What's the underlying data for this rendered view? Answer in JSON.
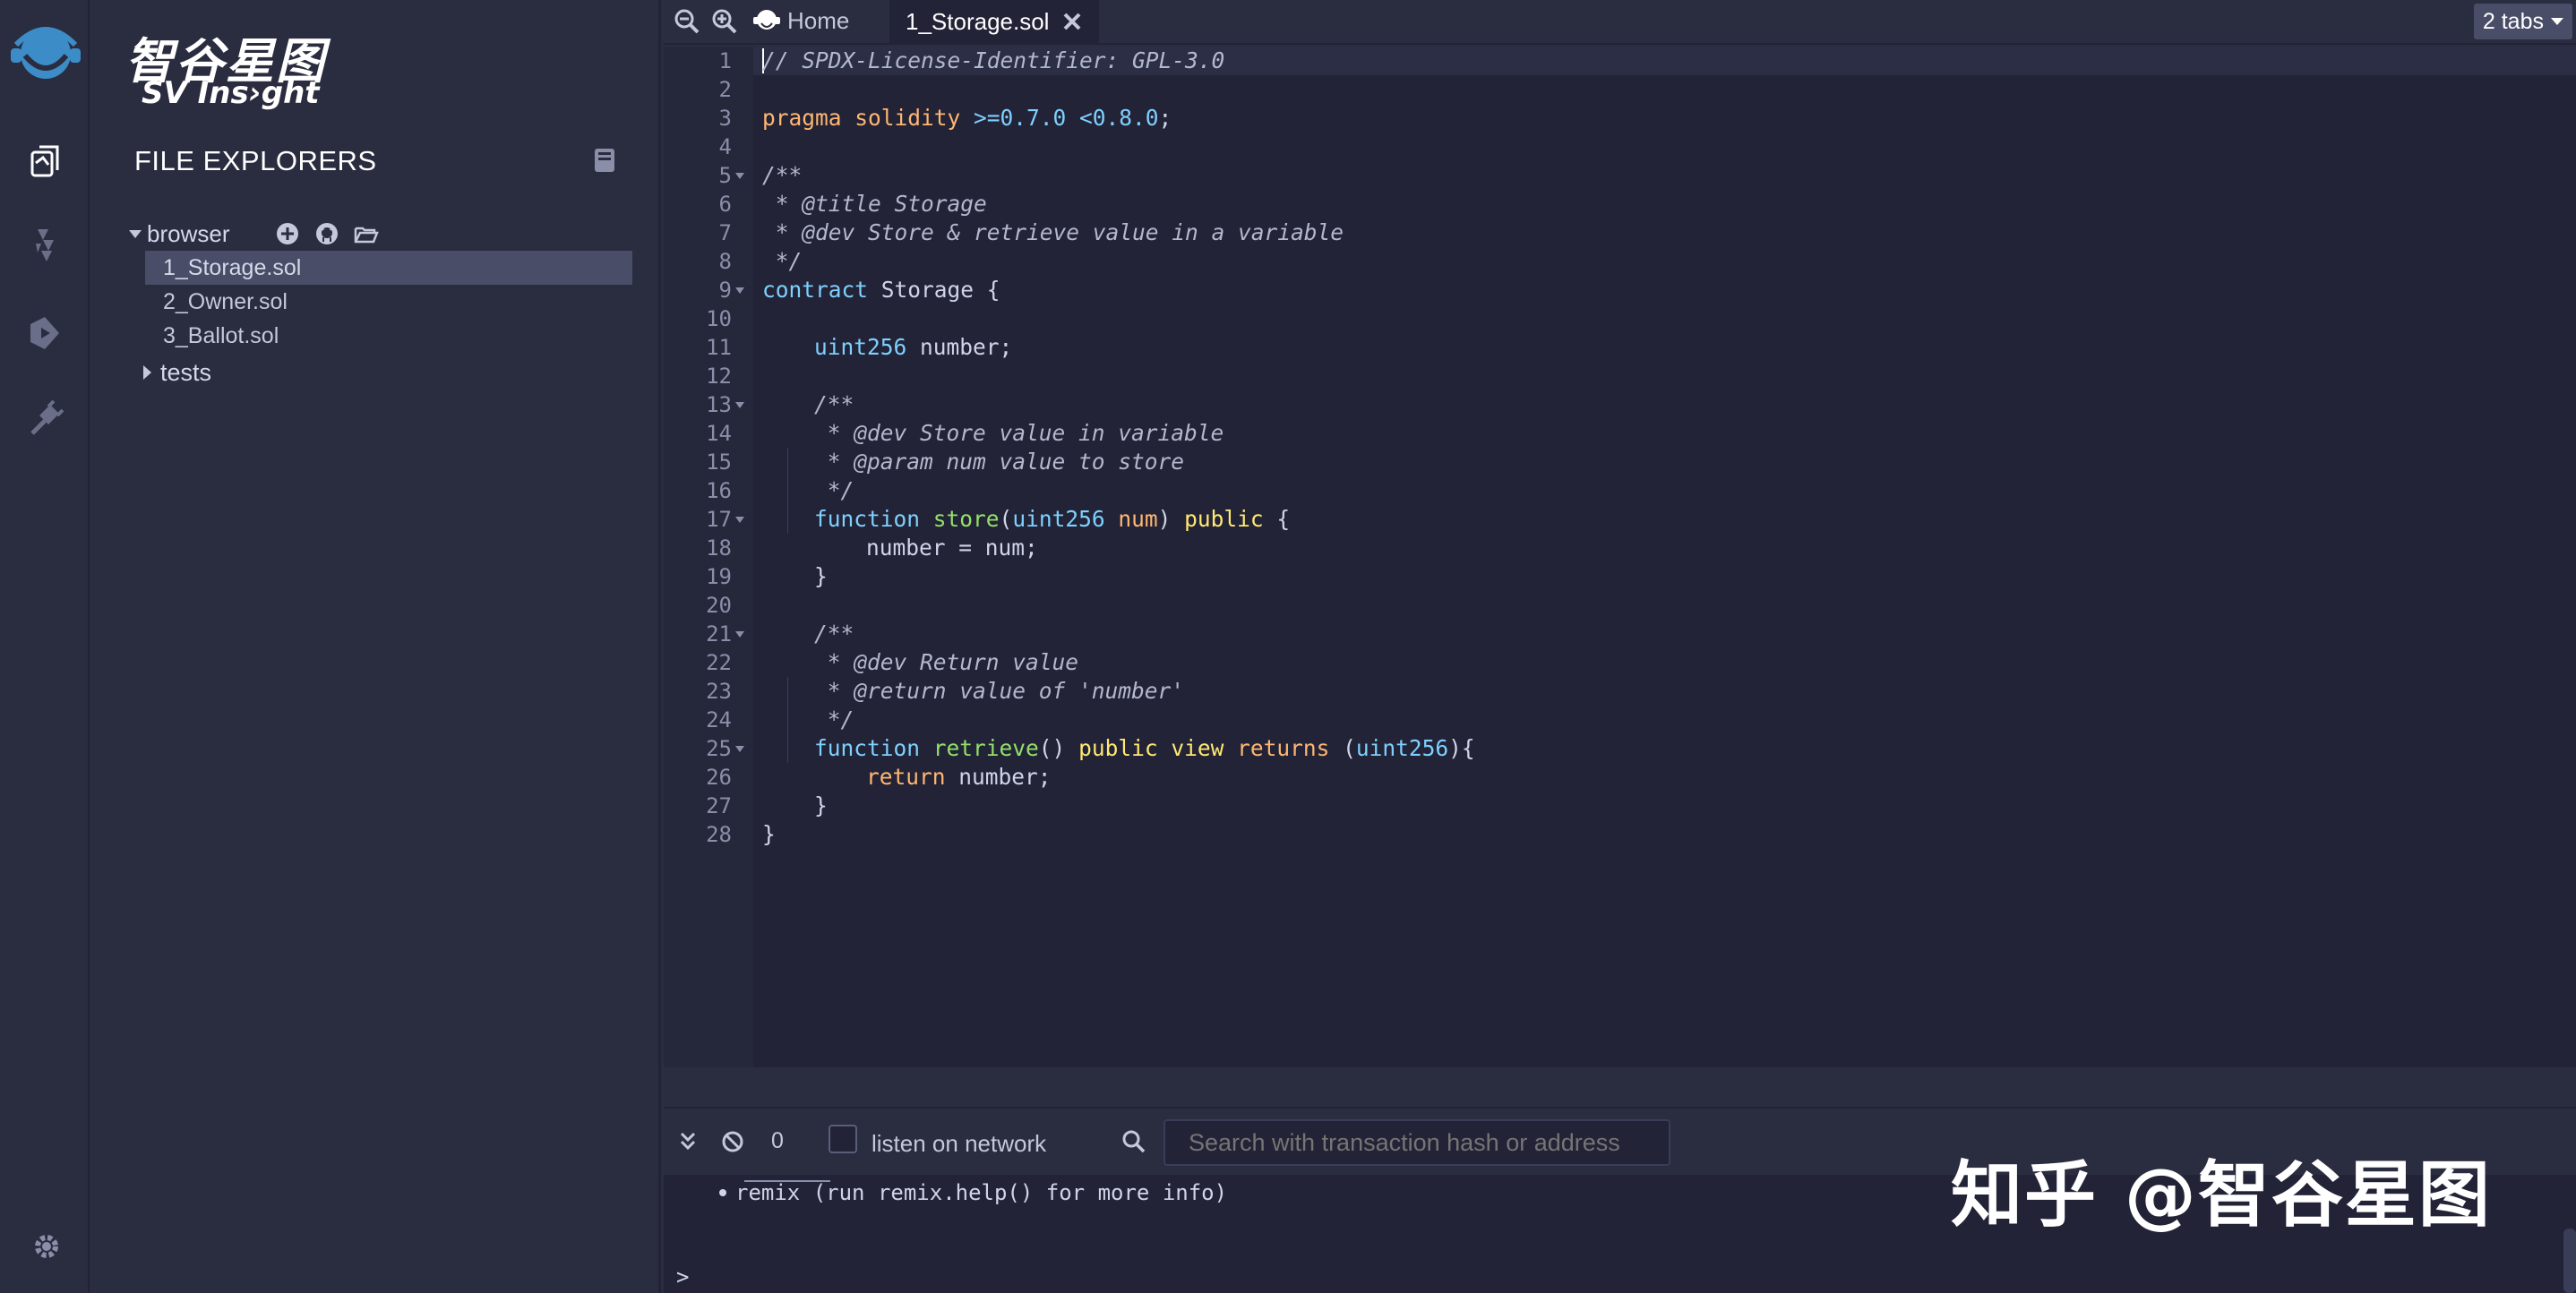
{
  "brand": {
    "name_cn": "智谷星图",
    "name_en": "SV Ins›ght"
  },
  "file_explorer": {
    "title": "FILE EXPLORERS",
    "root": "browser",
    "files": [
      "1_Storage.sol",
      "2_Owner.sol",
      "3_Ballot.sol"
    ],
    "active_file": "1_Storage.sol",
    "folders": [
      "tests"
    ]
  },
  "tabs": {
    "home_label": "Home",
    "active_label": "1_Storage.sol",
    "count_label": "2 tabs"
  },
  "editor": {
    "line_numbers": [
      "1",
      "2",
      "3",
      "4",
      "5",
      "6",
      "7",
      "8",
      "9",
      "10",
      "11",
      "12",
      "13",
      "14",
      "15",
      "16",
      "17",
      "18",
      "19",
      "20",
      "21",
      "22",
      "23",
      "24",
      "25",
      "26",
      "27",
      "28"
    ],
    "foldable_lines": [
      5,
      9,
      13,
      17,
      21,
      25
    ],
    "lines": {
      "l1": "// SPDX-License-Identifier: GPL-3.0",
      "l3_kw": "pragma solidity",
      "l3_ver": ">=0.7.0 <0.8.0",
      "l3_end": ";",
      "l5": "/**",
      "l6": " * @title Storage",
      "l7": " * @dev Store & retrieve value in a variable",
      "l8": " */",
      "l9_kw": "contract",
      "l9_rest": " Storage {",
      "l11_type": "uint256",
      "l11_rest": " number;",
      "l13": "/**",
      "l14": " * @dev Store value in variable",
      "l15": " * @param num value to store",
      "l16": " */",
      "l17_kw": "function",
      "l17_fn": "store",
      "l17_p1": "(",
      "l17_type": "uint256",
      "l17_param": "num",
      "l17_p2": ") ",
      "l17_pub": "public",
      "l17_end": " {",
      "l18": "number = num;",
      "l19": "}",
      "l21": "/**",
      "l22": " * @dev Return value",
      "l23": " * @return value of 'number'",
      "l24": " */",
      "l25_kw": "function",
      "l25_fn": "retrieve",
      "l25_paren": "() ",
      "l25_pubview": "public view",
      "l25_returns": " returns",
      "l25_p1": " (",
      "l25_type": "uint256",
      "l25_end": "){",
      "l26_kw": "return",
      "l26_rest": " number;",
      "l27": "}",
      "l28": "}"
    }
  },
  "terminal": {
    "pending_count": "0",
    "listen_label": "listen on network",
    "search_placeholder": "Search with transaction hash or address",
    "log_line": "remix (run remix.help() for more info)",
    "prompt": ">"
  },
  "watermark": "知乎 @智谷星图",
  "colors": {
    "background": "#2a2c3f",
    "editor_bg": "#222336",
    "active_file_bg": "#494d68",
    "keyword": "#ffb672",
    "type": "#7fd0ff",
    "function": "#93e06a",
    "visibility": "#ffe873"
  }
}
